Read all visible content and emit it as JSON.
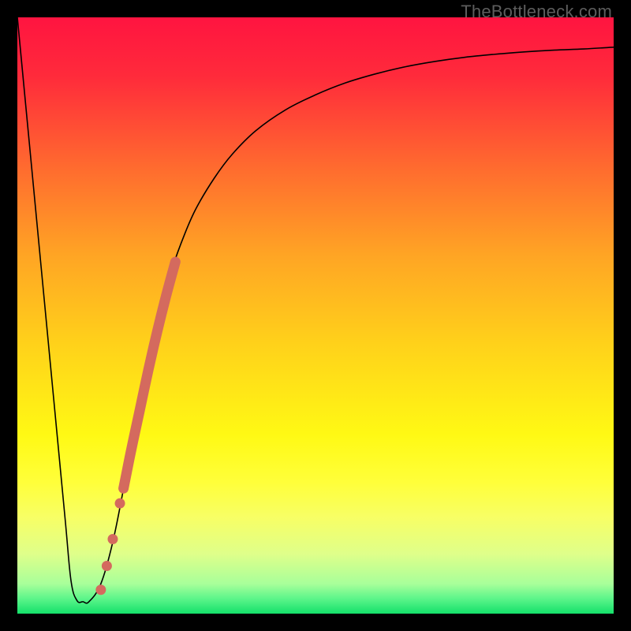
{
  "watermark": "TheBottleneck.com",
  "chart_data": {
    "type": "line",
    "title": "",
    "xlabel": "",
    "ylabel": "",
    "xlim": [
      0,
      100
    ],
    "ylim": [
      0,
      100
    ],
    "gradient_stops": [
      {
        "offset": 0.0,
        "color": "#ff1440"
      },
      {
        "offset": 0.1,
        "color": "#ff2b3b"
      },
      {
        "offset": 0.25,
        "color": "#ff6a2f"
      },
      {
        "offset": 0.4,
        "color": "#ffa524"
      },
      {
        "offset": 0.55,
        "color": "#ffd21a"
      },
      {
        "offset": 0.7,
        "color": "#fff914"
      },
      {
        "offset": 0.78,
        "color": "#ffff3a"
      },
      {
        "offset": 0.84,
        "color": "#f7ff66"
      },
      {
        "offset": 0.9,
        "color": "#dfff8a"
      },
      {
        "offset": 0.95,
        "color": "#a8ff9a"
      },
      {
        "offset": 0.975,
        "color": "#5cf58a"
      },
      {
        "offset": 1.0,
        "color": "#14e06a"
      }
    ],
    "series": [
      {
        "name": "bottleneck-curve",
        "color": "#000000",
        "stroke_width": 1.6,
        "x": [
          0,
          2,
          4,
          6,
          8,
          9,
          10,
          11,
          12,
          14,
          16,
          18,
          20,
          22,
          24,
          26,
          28,
          30,
          33,
          36,
          40,
          45,
          50,
          55,
          60,
          65,
          70,
          75,
          80,
          85,
          90,
          95,
          100
        ],
        "y": [
          100,
          79,
          58,
          37,
          16,
          5.5,
          2.2,
          2.0,
          2.0,
          5,
          12,
          22,
          33,
          43,
          51,
          58,
          63.5,
          68,
          73,
          77,
          81,
          84.5,
          87,
          89,
          90.5,
          91.7,
          92.6,
          93.3,
          93.8,
          94.2,
          94.5,
          94.7,
          95
        ]
      }
    ],
    "scatter": {
      "name": "highlight-dots",
      "color": "#d46a5e",
      "radius": 6.5,
      "points": [
        {
          "x": 14.0,
          "y": 4.0
        },
        {
          "x": 15.0,
          "y": 8.0
        },
        {
          "x": 16.0,
          "y": 12.5
        },
        {
          "x": 17.2,
          "y": 18.5
        }
      ]
    },
    "thick_segment": {
      "name": "highlight-band",
      "color": "#d46a5e",
      "stroke_width": 13,
      "x": [
        17.8,
        19,
        20.5,
        22,
        23.5,
        25,
        26.5
      ],
      "y": [
        21,
        27,
        34,
        41,
        47.5,
        53.5,
        59
      ]
    }
  }
}
